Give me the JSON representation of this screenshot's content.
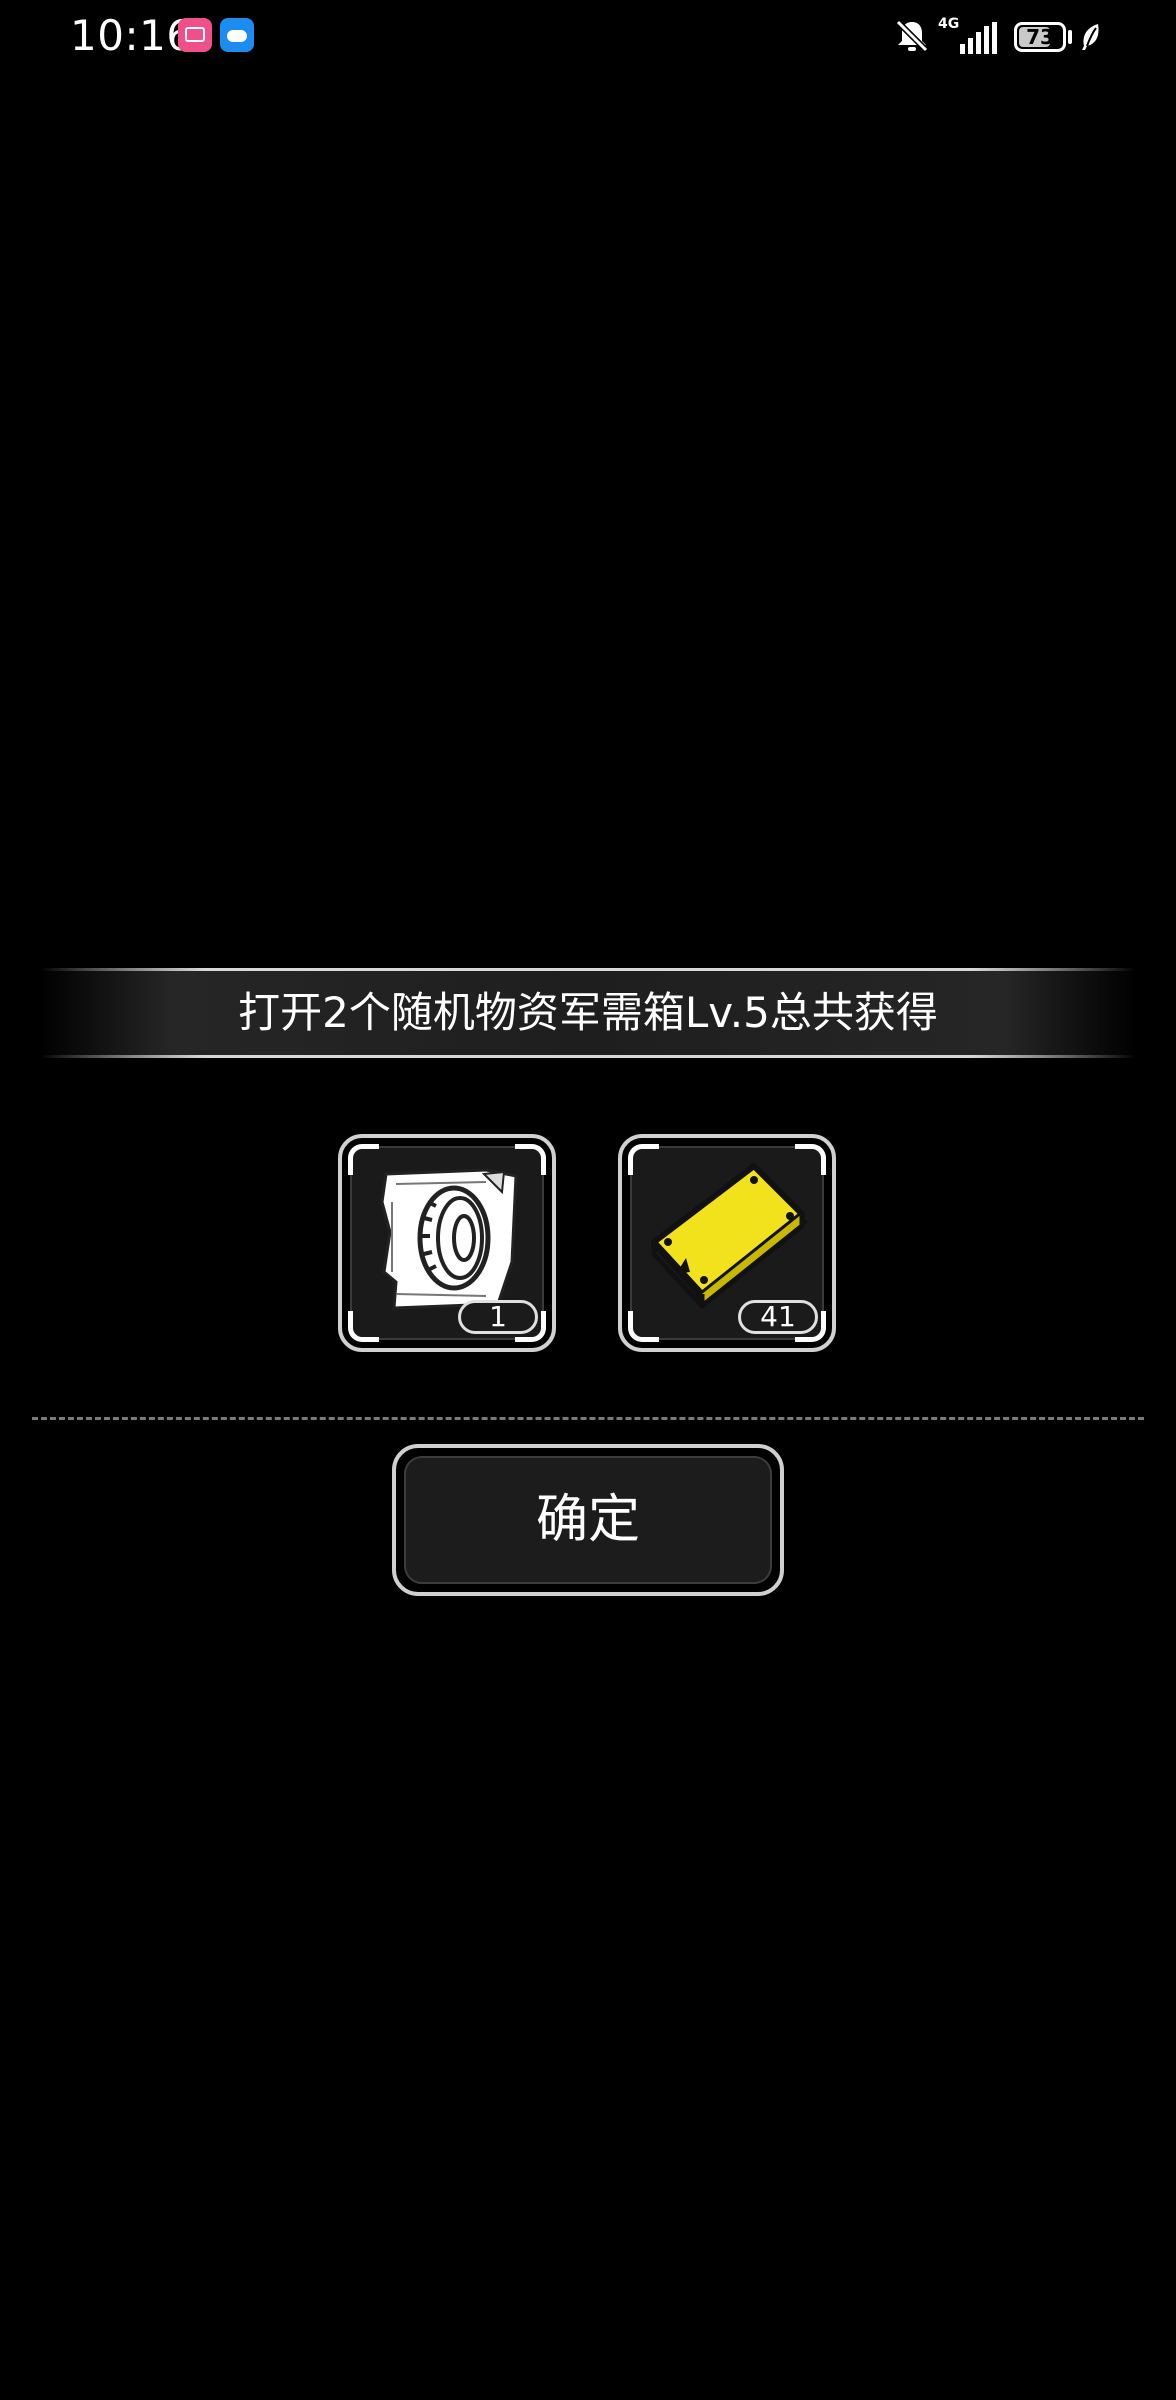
{
  "status_bar": {
    "time": "10:16",
    "network_label": "4G",
    "battery_level": "73",
    "battery_fraction": 0.73,
    "icons": [
      "bilibili-app-icon",
      "weather-app-icon",
      "bell-off-icon",
      "signal-icon",
      "battery-icon",
      "leaf-icon"
    ]
  },
  "dialog": {
    "title": "打开2个随机物资军需箱Lv.5总共获得",
    "rewards": [
      {
        "icon": "tire-blueprint-icon",
        "quantity": "1"
      },
      {
        "icon": "gold-plate-icon",
        "quantity": "41"
      }
    ],
    "confirm_label": "确定"
  },
  "colors": {
    "background": "#000000",
    "text": "#ffffff",
    "frame": "#d0d0d0",
    "gold": "#f2e21c"
  }
}
